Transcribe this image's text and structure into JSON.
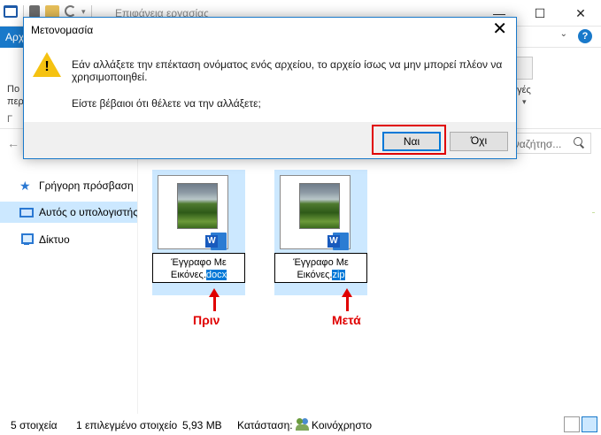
{
  "window": {
    "title": "Επιφάνεια εργασίας",
    "controls": {
      "minimize": "—",
      "maximize": "☐",
      "close": "✕"
    }
  },
  "ribbon": {
    "file_tab": "Αρχ",
    "partial_left_1": "Πο",
    "partial_left_2": "περ",
    "partial_left_3": "Γ",
    "partial_right": "ογές",
    "help": "?"
  },
  "search": {
    "placeholder": "Αναζήτησ..."
  },
  "sidebar": {
    "items": [
      {
        "label": "Γρήγορη πρόσβαση",
        "icon": "star-icon"
      },
      {
        "label": "Αυτός ο υπολογιστής",
        "icon": "computer-icon"
      },
      {
        "label": "Δίκτυο",
        "icon": "network-icon"
      }
    ]
  },
  "files": [
    {
      "name_line1": "Έγγραφο Με",
      "name_line2_plain": "Εικόνες.",
      "name_line2_selected": "docx",
      "icon": "word-icon",
      "caption": "Πριν"
    },
    {
      "name_line1": "Έγγραφο Με",
      "name_line2_plain": "Εικόνες.",
      "name_line2_selected": "zip",
      "icon": "word-icon",
      "caption": "Μετά"
    }
  ],
  "statusbar": {
    "count": "5 στοιχεία",
    "selected": "1 επιλεγμένο στοιχείο",
    "size": "5,93 MB",
    "state_label": "Κατάσταση:",
    "state_value": "Κοινόχρηστο"
  },
  "dialog": {
    "title": "Μετονομασία",
    "close": "✕",
    "message": "Εάν αλλάξετε την επέκταση ονόματος ενός αρχείου, το αρχείο ίσως να μην μπορεί πλέον να χρησιμοποιηθεί.",
    "question": "Είστε βέβαιοι ότι θέλετε να την αλλάξετε;",
    "yes_label": "Ναι",
    "no_label": "Όχι",
    "icon": "warning-icon",
    "highlight_color": "#e00000"
  },
  "colors": {
    "accent": "#1979ca",
    "selection": "#cce8ff",
    "text_selection": "#0078d7",
    "annotation_red": "#e00000"
  }
}
